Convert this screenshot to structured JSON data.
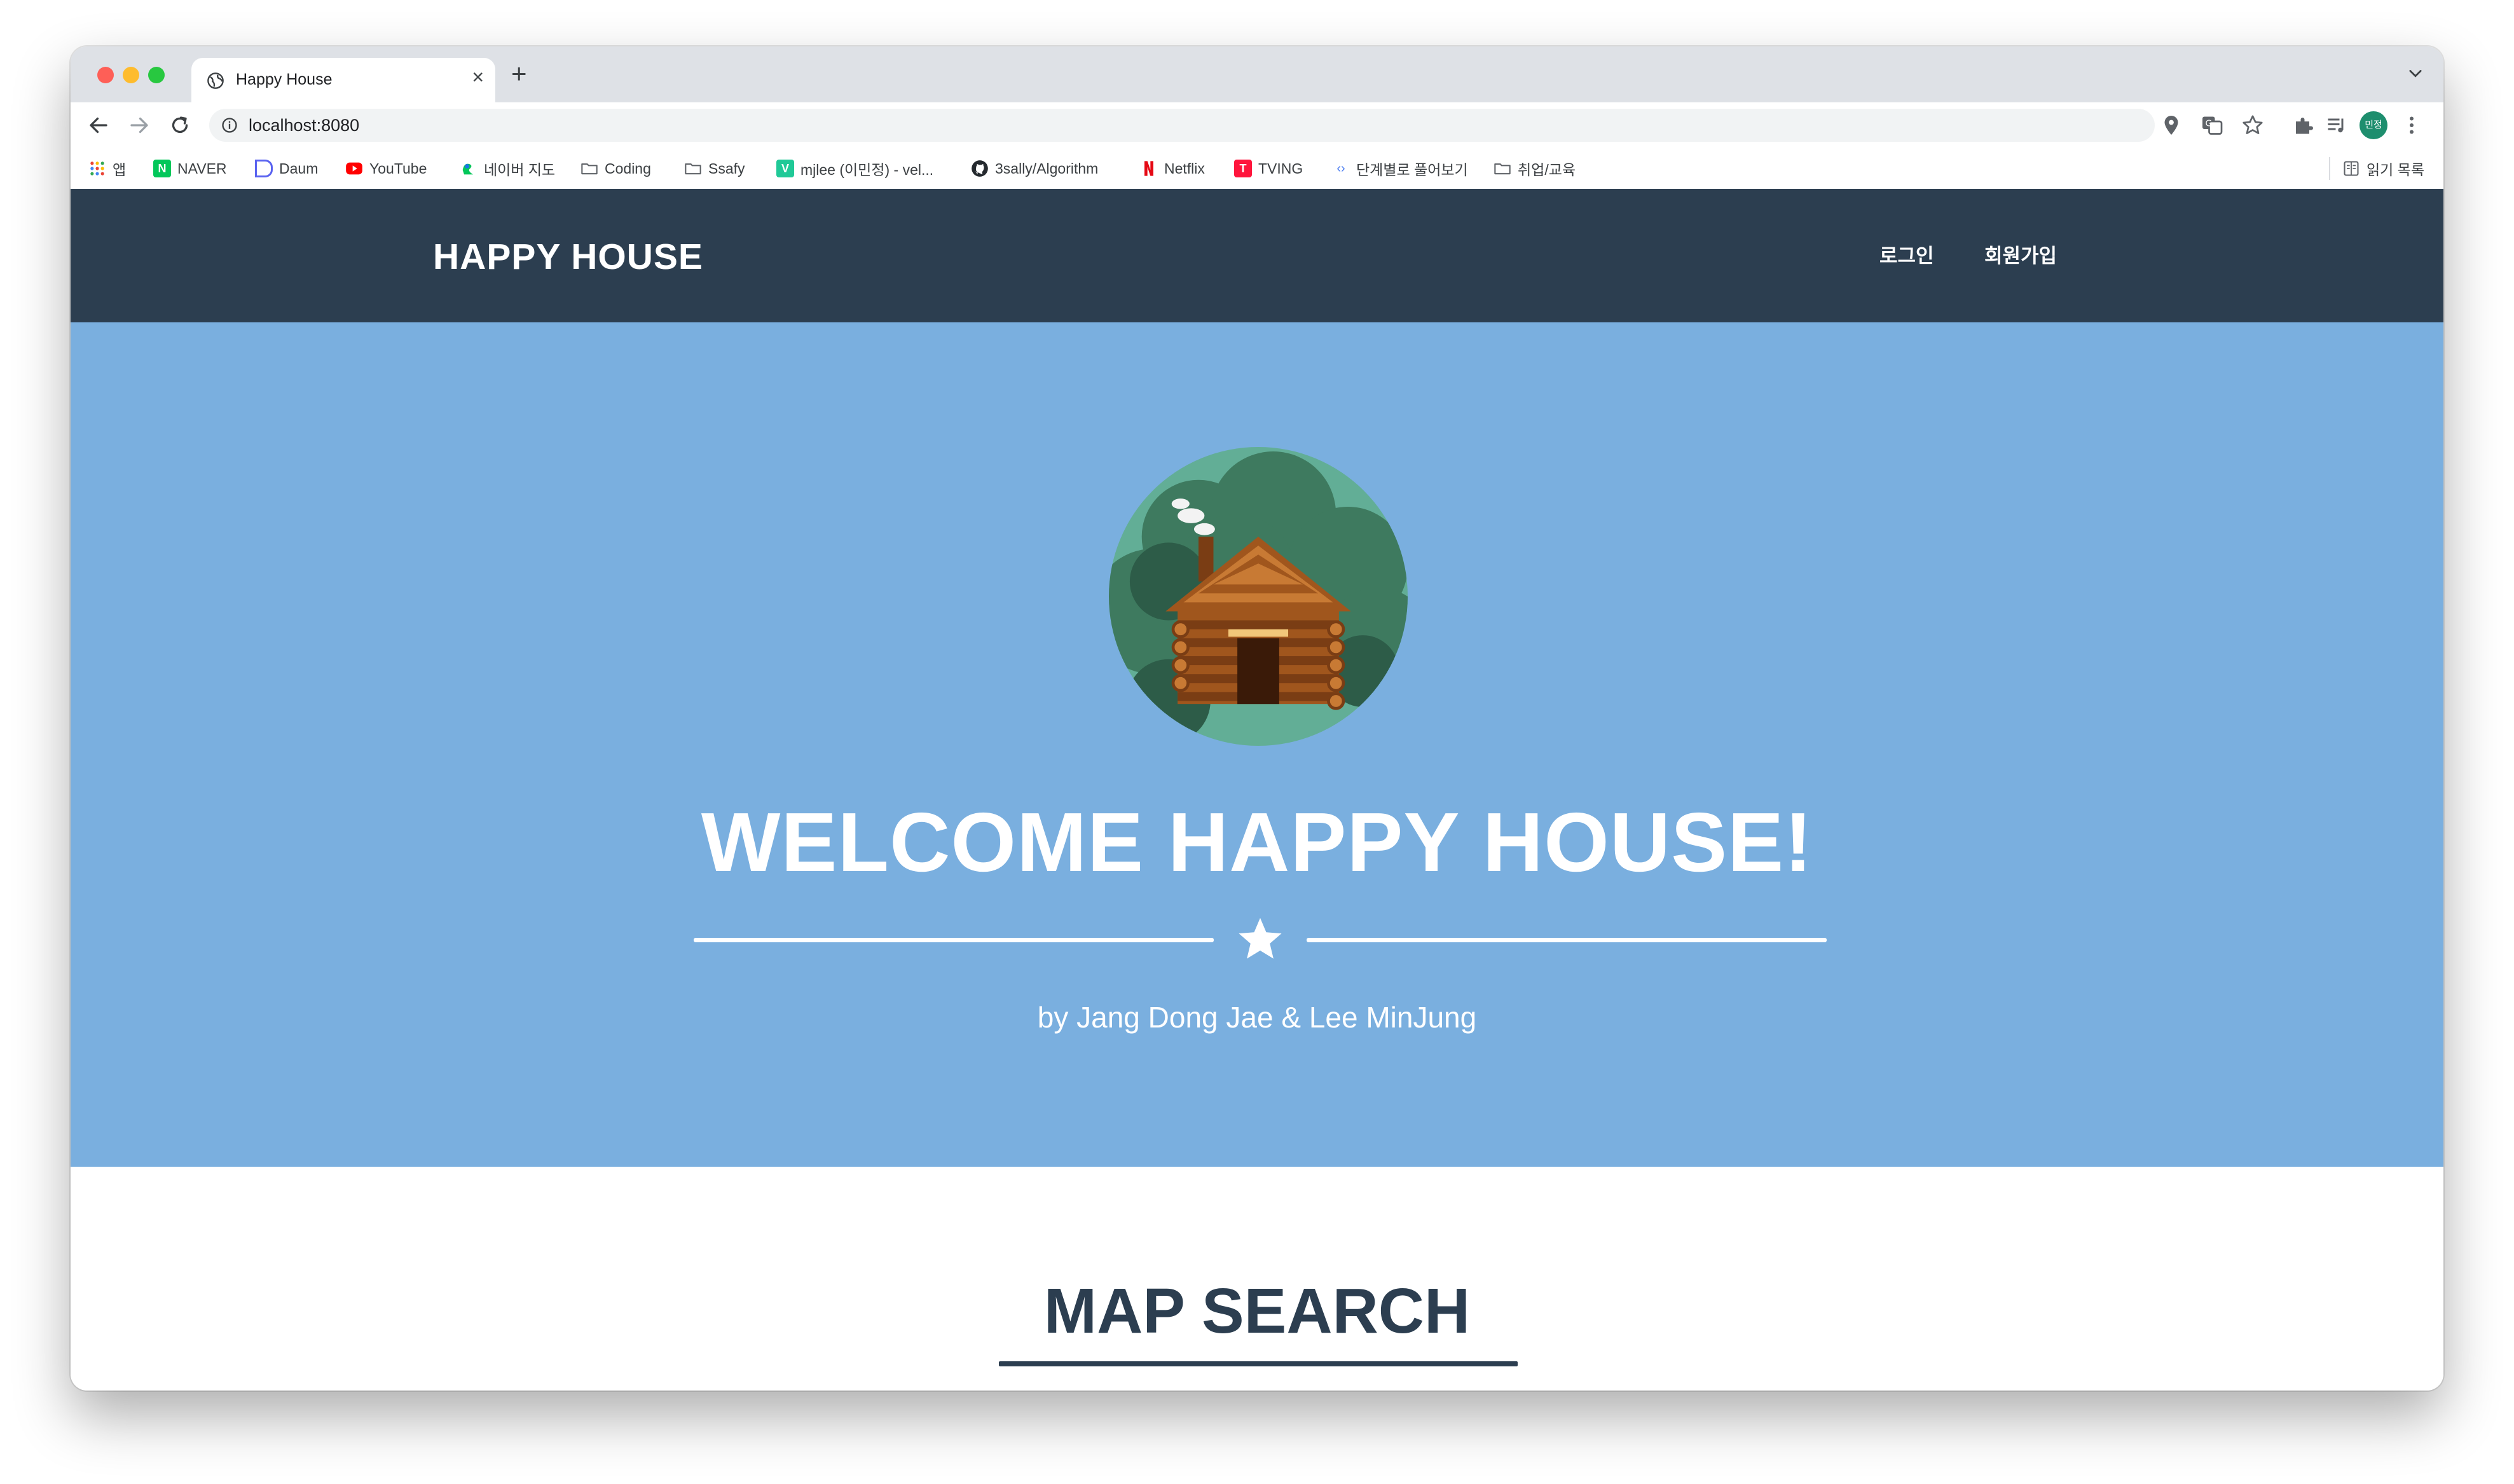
{
  "browser": {
    "tab": {
      "title": "Happy House"
    },
    "address": {
      "url": "localhost:8080"
    },
    "profile_initials": "민정",
    "bookmarks": [
      {
        "label": "앱",
        "icon": "apps-grid-icon"
      },
      {
        "label": "NAVER",
        "icon": "naver-icon"
      },
      {
        "label": "Daum",
        "icon": "daum-icon"
      },
      {
        "label": "YouTube",
        "icon": "youtube-icon"
      },
      {
        "label": "네이버 지도",
        "icon": "naver-map-icon"
      },
      {
        "label": "Coding",
        "icon": "folder-icon"
      },
      {
        "label": "Ssafy",
        "icon": "folder-icon"
      },
      {
        "label": "mjlee (이민정) - vel...",
        "icon": "velog-icon"
      },
      {
        "label": "3sally/Algorithm",
        "icon": "github-icon"
      },
      {
        "label": "Netflix",
        "icon": "netflix-icon"
      },
      {
        "label": "TVING",
        "icon": "tving-icon"
      },
      {
        "label": "단계별로 풀어보기",
        "icon": "code-icon"
      },
      {
        "label": "취업/교육",
        "icon": "folder-icon"
      }
    ],
    "reading_list": "읽기 목록"
  },
  "navbar": {
    "brand": "HAPPY HOUSE",
    "links": [
      "로그인",
      "회원가입"
    ]
  },
  "masthead": {
    "title": "WELCOME HAPPY HOUSE!",
    "subtitle": "by Jang Dong Jae & Lee MinJung"
  },
  "map_section": {
    "title": "MAP SEARCH"
  },
  "colors": {
    "navbar_bg": "#2c3e50",
    "masthead_bg": "#7aafdf",
    "heading_text": "#2c3e50"
  }
}
